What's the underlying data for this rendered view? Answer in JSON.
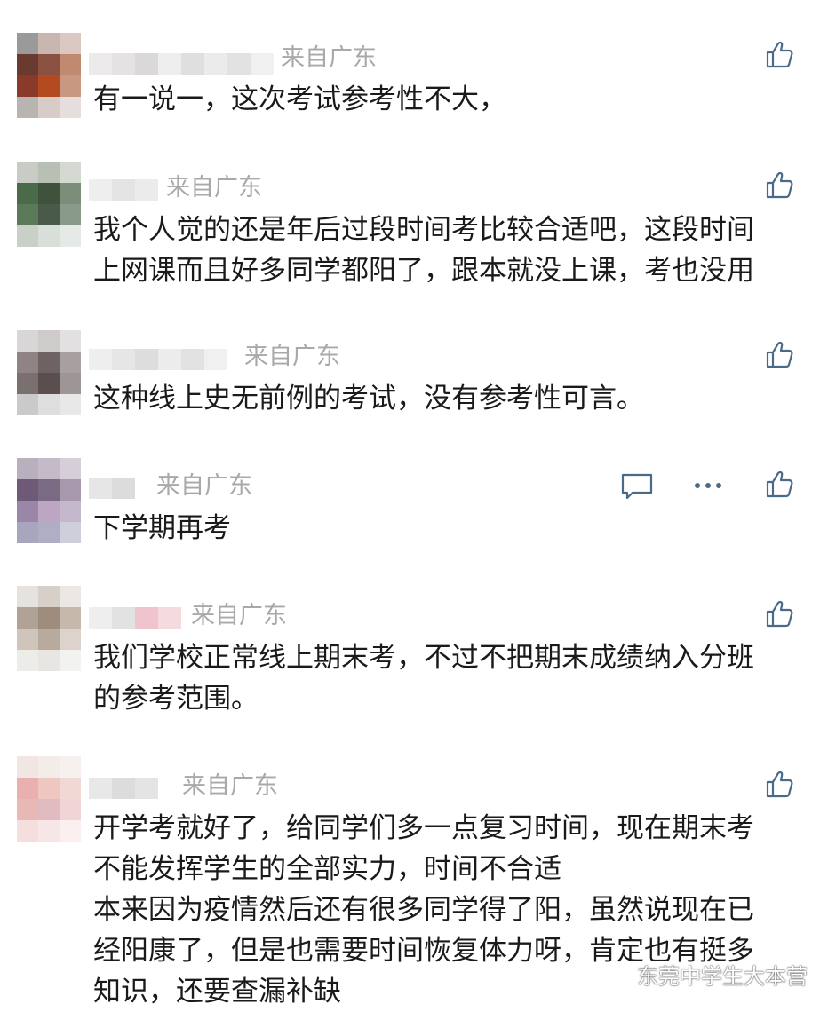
{
  "comments": [
    {
      "location": "来自广东",
      "text": "有一说一，这次考试参考性不大，"
    },
    {
      "location": "来自广东",
      "text": "我个人觉的还是年后过段时间考比较合适吧，这段时间\n上网课而且好多同学都阳了，跟本就没上课，考也没用"
    },
    {
      "location": "来自广东",
      "text": "这种线上史无前例的考试，没有参考性可言。"
    },
    {
      "location": "来自广东",
      "text": "下学期再考"
    },
    {
      "location": "来自广东",
      "text": "我们学校正常线上期末考，不过不把期末成绩纳入分班\n的参考范围。"
    },
    {
      "location": "来自广东",
      "text": "开学考就好了，给同学们多一点复习时间，现在期末考\n不能发挥学生的全部实力，时间不合适\n本来因为疫情然后还有很多同学得了阳，虽然说现在已\n经阳康了，但是也需要时间恢复体力呀，肯定也有挺多\n知识，还要查漏补缺"
    }
  ],
  "icons": {
    "like": "thumbs-up-icon",
    "reply": "comment-icon",
    "more": "more-icon",
    "brand": "wechat-icon"
  },
  "watermark": "东莞中学生大本营",
  "colors": {
    "location": "#a9a9a9",
    "text": "#1a1a1a",
    "icon": "#4a6a8a"
  }
}
